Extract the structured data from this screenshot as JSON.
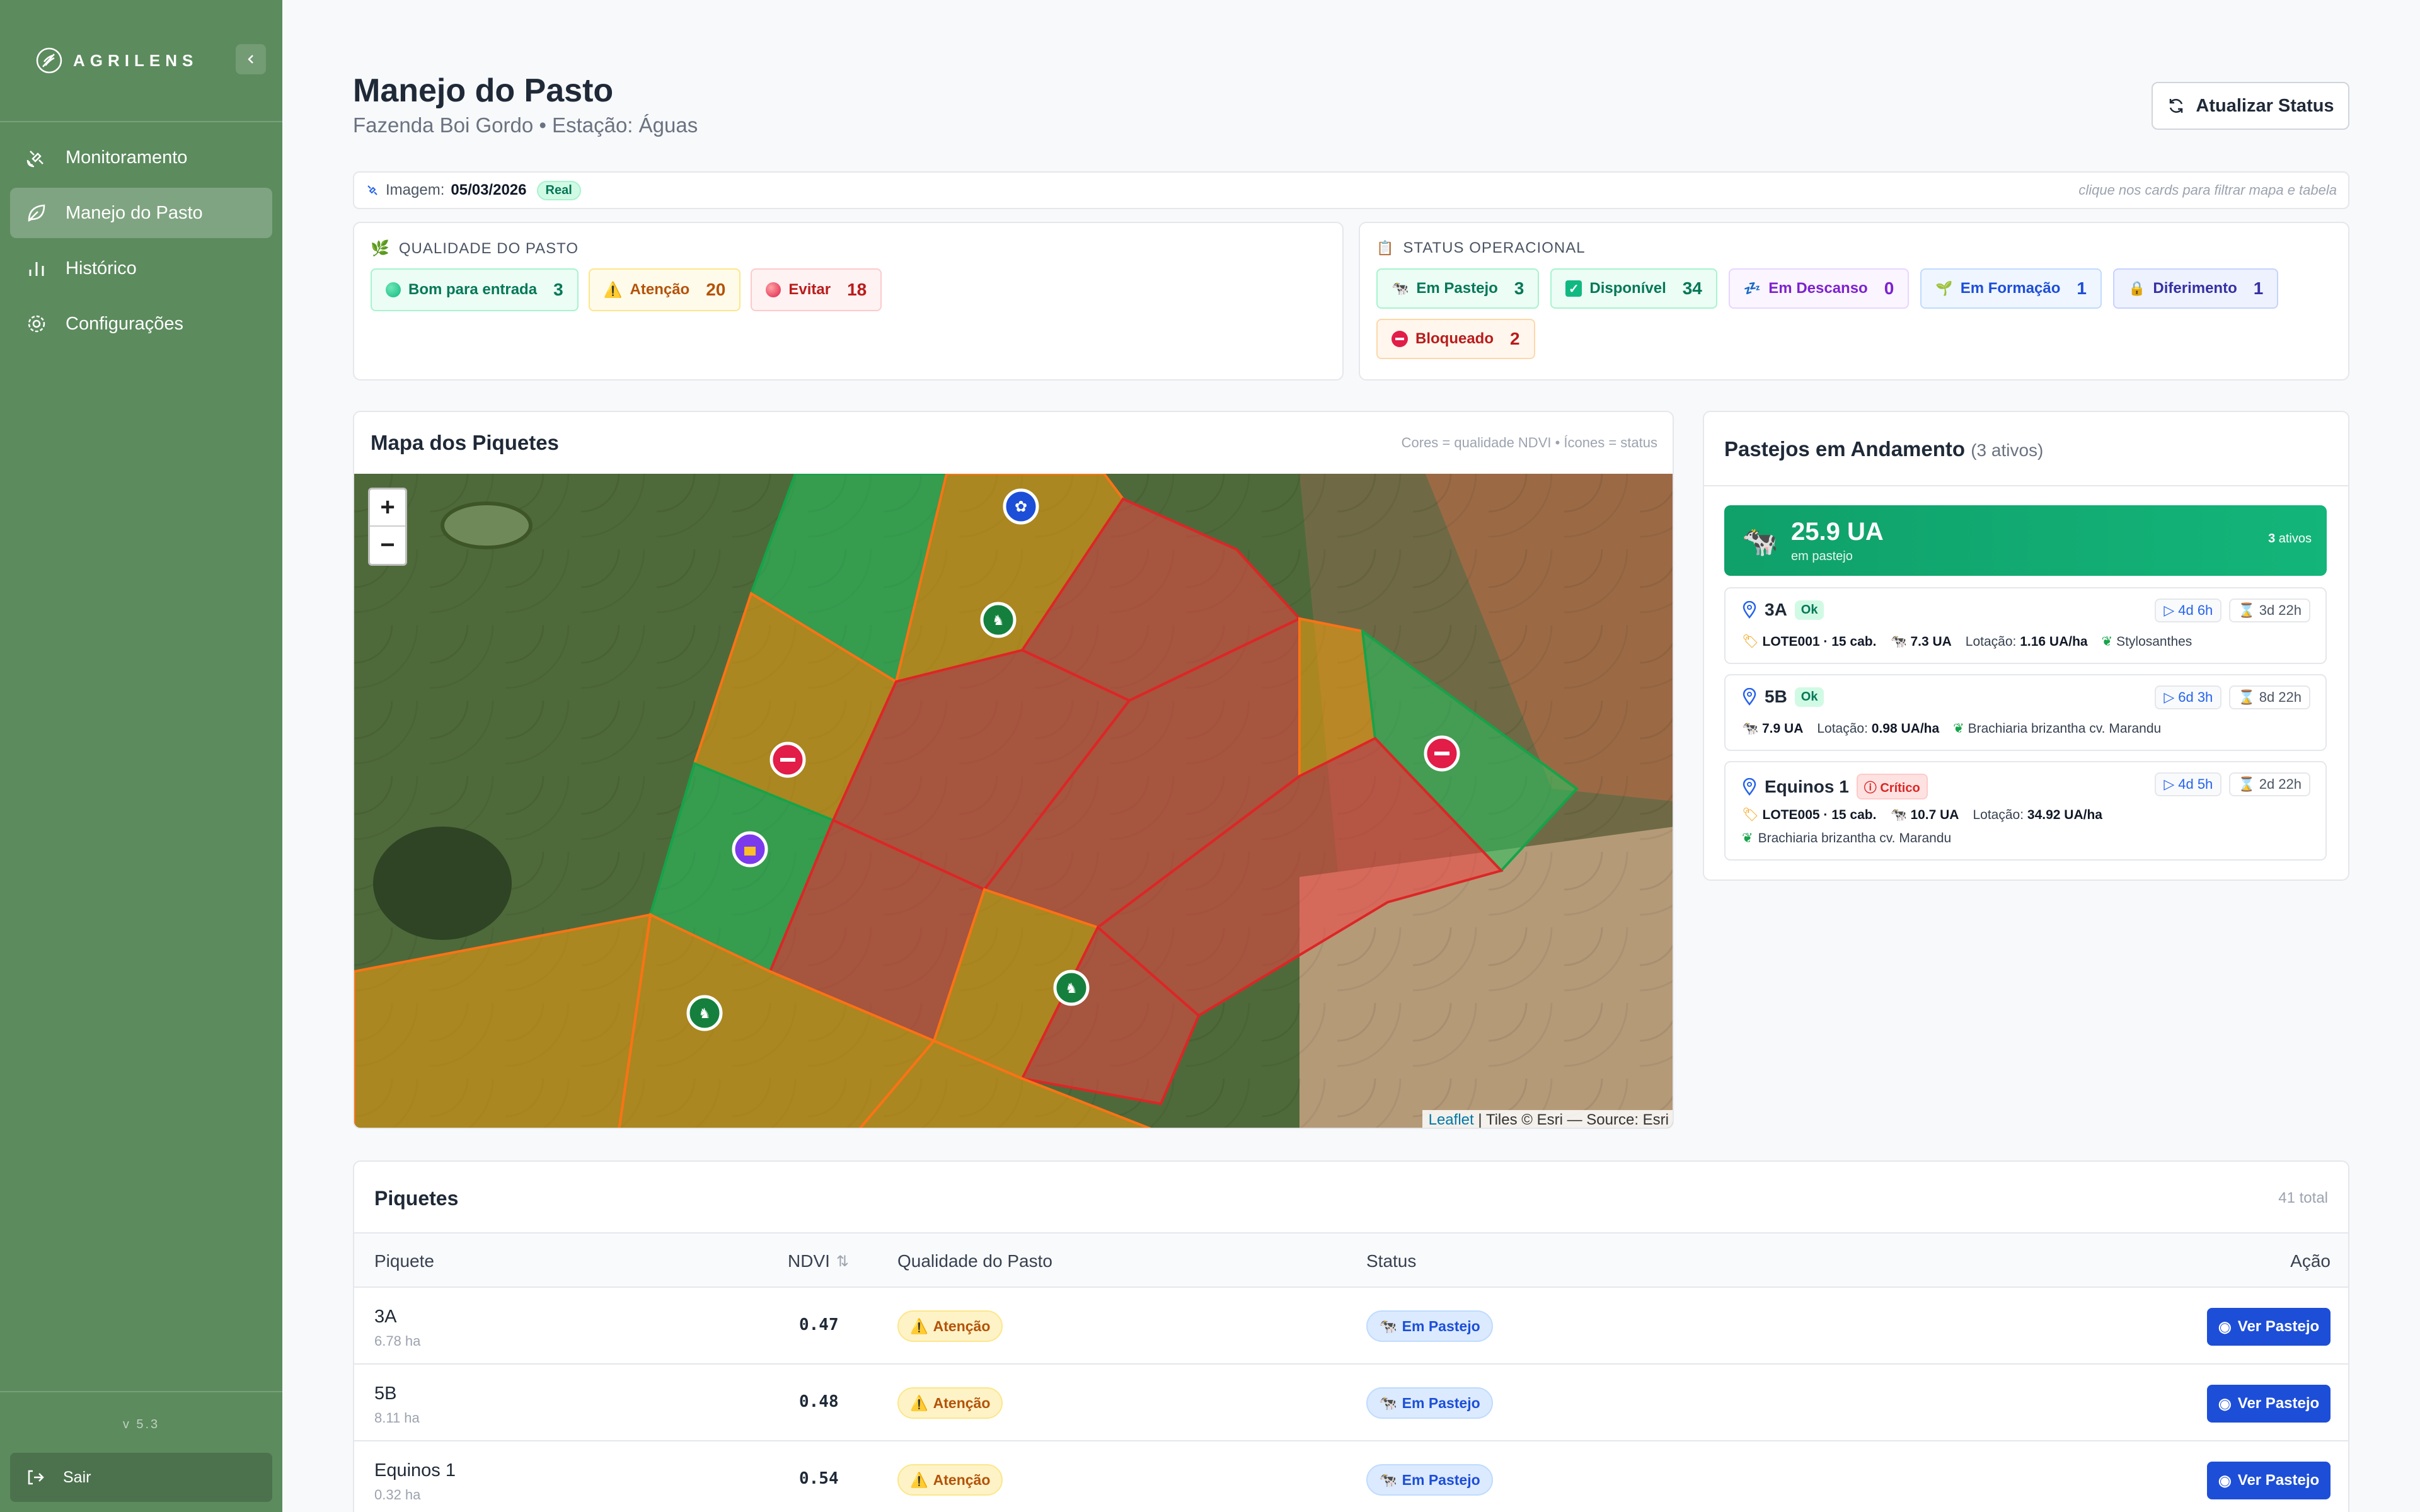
{
  "app": {
    "logo_text": "AGRILENS",
    "version": "v 5.3"
  },
  "sidebar": {
    "items": [
      {
        "label": "Monitoramento",
        "icon": "satellite-icon"
      },
      {
        "label": "Manejo do Pasto",
        "icon": "leaf-icon",
        "active": true
      },
      {
        "label": "Histórico",
        "icon": "bar-chart-icon"
      },
      {
        "label": "Configurações",
        "icon": "gear-icon"
      }
    ],
    "logout_label": "Sair"
  },
  "header": {
    "title": "Manejo do Pasto",
    "subtitle": "Fazenda Boi Gordo • Estação: Águas",
    "refresh_label": "Atualizar Status"
  },
  "info_bar": {
    "image_label": "Imagem:",
    "image_date": "05/03/2026",
    "image_badge": "Real",
    "hint": "clique nos cards para filtrar mapa e tabela"
  },
  "quality": {
    "title": "Qualidade do Pasto",
    "chips": [
      {
        "label": "Bom para entrada",
        "count": "3"
      },
      {
        "label": "Atenção",
        "count": "20"
      },
      {
        "label": "Evitar",
        "count": "18"
      }
    ]
  },
  "status": {
    "title": "Status Operacional",
    "chips": [
      {
        "label": "Em Pastejo",
        "count": "3"
      },
      {
        "label": "Disponível",
        "count": "34"
      },
      {
        "label": "Em Descanso",
        "count": "0"
      },
      {
        "label": "Em Formação",
        "count": "1"
      },
      {
        "label": "Diferimento",
        "count": "1"
      },
      {
        "label": "Bloqueado",
        "count": "2"
      }
    ]
  },
  "map": {
    "title": "Mapa dos Piquetes",
    "hint": "Cores = qualidade NDVI • Ícones = status",
    "zoom_in": "+",
    "zoom_out": "−",
    "attribution_link": "Leaflet",
    "attribution_text": "| Tiles © Esri — Source: Esri"
  },
  "pastejos": {
    "title": "Pastejos em Andamento",
    "count_label": "(3 ativos)",
    "summary_value": "25.9 UA",
    "summary_label": "em pastejo",
    "summary_active_count": "3",
    "summary_active_label": "ativos",
    "items": [
      {
        "name": "3A",
        "status": "Ok",
        "elapsed": "4d 6h",
        "remaining": "3d 22h",
        "lote": "LOTE001 · 15 cab.",
        "ua": "7.3 UA",
        "lot_label": "Lotação:",
        "lotacao": "1.16 UA/ha",
        "forage": "Stylosanthes"
      },
      {
        "name": "5B",
        "status": "Ok",
        "elapsed": "6d 3h",
        "remaining": "8d 22h",
        "ua": "7.9 UA",
        "lot_label": "Lotação:",
        "lotacao": "0.98 UA/ha",
        "forage": "Brachiaria brizantha cv. Marandu"
      },
      {
        "name": "Equinos 1",
        "status": "Crítico",
        "elapsed": "4d 5h",
        "remaining": "2d 22h",
        "lote": "LOTE005 · 15 cab.",
        "ua": "10.7 UA",
        "lot_label": "Lotação:",
        "lotacao": "34.92 UA/ha",
        "forage": "Brachiaria brizantha cv. Marandu"
      }
    ]
  },
  "table": {
    "title": "Piquetes",
    "total": "41 total",
    "columns": [
      "Piquete",
      "NDVI",
      "Qualidade do Pasto",
      "Status",
      "Ação"
    ],
    "rows": [
      {
        "name": "3A",
        "area": "6.78 ha",
        "ndvi": "0.47",
        "quality": "Atenção",
        "status": "Em Pastejo",
        "action": "Ver Pastejo"
      },
      {
        "name": "5B",
        "area": "8.11 ha",
        "ndvi": "0.48",
        "quality": "Atenção",
        "status": "Em Pastejo",
        "action": "Ver Pastejo"
      },
      {
        "name": "Equinos 1",
        "area": "0.32 ha",
        "ndvi": "0.54",
        "quality": "Atenção",
        "status": "Em Pastejo",
        "action": "Ver Pastejo"
      }
    ]
  },
  "colors": {
    "sidebar": "#5c8b5e",
    "good": "#10b981",
    "attention": "#f59e0b",
    "avoid": "#ef4444",
    "primary_button": "#1d4ed8"
  }
}
